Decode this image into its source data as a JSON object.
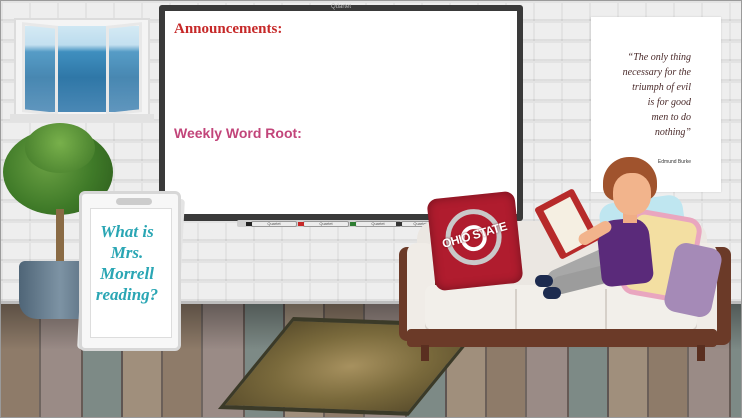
{
  "board": {
    "brand": "Quartet",
    "announcements_heading": "Announcements:",
    "word_root_heading": "Weekly Word Root:",
    "markers": [
      "Quartet",
      "Quartet",
      "Quartet",
      "Quartet"
    ]
  },
  "quote": {
    "lines": [
      "“The only thing",
      "necessary for the",
      "triumph of evil",
      "is for good",
      "men to do",
      "nothing”"
    ],
    "author": "Edmund Burke"
  },
  "sign": {
    "lines": [
      "What is",
      "Mrs.",
      "Morrell",
      "reading?"
    ]
  },
  "pillow": {
    "text": "OHIO STATE"
  },
  "colors": {
    "announcements": "#c62828",
    "word_root": "#c2457a",
    "sign_text": "#2aa6b4",
    "pillow": "#b01c2e"
  }
}
